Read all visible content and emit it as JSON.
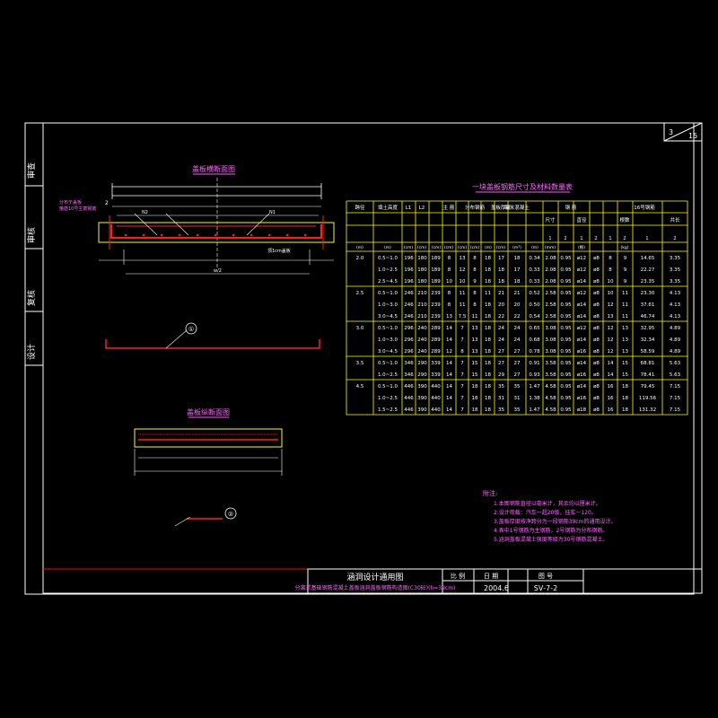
{
  "sheet": {
    "page_no": "3",
    "page_total": "15"
  },
  "side_labels": [
    "审查",
    "审核",
    "复核",
    "设计"
  ],
  "title_block": {
    "title": "涵洞设计通用图",
    "subtitle": "分离式基础钢筋混凝土盖板涵洞盖板钢筋构造图(C30砼)(h=39cm)",
    "scale_label": "比 例",
    "date_label": "日 期",
    "drawing_no_label": "图 号",
    "date_value": "2004.6",
    "drawing_no_value": "SⅤ-7-2"
  },
  "left_views": {
    "cross_section_title": "盖板横断面图",
    "detail_title": "盖板纵断面图",
    "callouts": [
      "①",
      "②"
    ],
    "notes": [
      "分布于盖板",
      "箍筋10号主筋钢筋",
      "2",
      "N2",
      "N1",
      "顶1cm盖板",
      "w/2"
    ]
  },
  "table": {
    "title": "一块盖板钢筋尺寸及材料数量表",
    "header_top": [
      "跨径",
      "填土高度",
      "L1",
      "L2",
      "主 筋",
      "分布钢筋",
      "盖板厚度",
      "每米混凝土",
      "钢 筋",
      "16号钢筋"
    ],
    "header_sub": [
      "尺寸",
      "直径",
      "根数",
      "共长"
    ],
    "units": [
      "(m)",
      "(m)",
      "(cm)",
      "(cm)",
      "(cm)",
      "(cm)",
      "(cm)",
      "(cm)",
      "(m)",
      "(cm)",
      "(m³)",
      "(m)",
      "(mm)",
      "(根)",
      "(kg)"
    ],
    "col_index": [
      "1",
      "2",
      "1",
      "2",
      "1",
      "2",
      "1",
      "2"
    ],
    "rows": [
      [
        "2.0",
        "0.5~1.0",
        "196",
        "180",
        "189",
        "8",
        "13",
        "8",
        "18",
        "17",
        "18",
        "0.34",
        "2.08",
        "0.95",
        "ø12",
        "ø8",
        "8",
        "9",
        "14.65",
        "3.35"
      ],
      [
        "",
        "1.0~2.5",
        "196",
        "180",
        "189",
        "8",
        "12",
        "8",
        "18",
        "18",
        "17",
        "0.33",
        "2.08",
        "0.95",
        "ø12",
        "ø8",
        "8",
        "9",
        "22.27",
        "3.35"
      ],
      [
        "",
        "2.5~4.5",
        "196",
        "180",
        "189",
        "10",
        "10",
        "9",
        "18",
        "18",
        "18",
        "0.33",
        "2.08",
        "0.95",
        "ø14",
        "ø8",
        "10",
        "9",
        "23.35",
        "3.35"
      ],
      [
        "2.5",
        "0.5~1.0",
        "246",
        "210",
        "239",
        "8",
        "11",
        "8",
        "11",
        "21",
        "21",
        "0.52",
        "2.58",
        "0.95",
        "ø12",
        "ø8",
        "10",
        "11",
        "23.30",
        "4.13"
      ],
      [
        "",
        "1.0~3.0",
        "246",
        "210",
        "239",
        "8",
        "11",
        "8",
        "18",
        "20",
        "20",
        "0.50",
        "2.58",
        "0.95",
        "ø14",
        "ø8",
        "12",
        "11",
        "37.61",
        "4.13"
      ],
      [
        "",
        "3.0~4.5",
        "246",
        "210",
        "239",
        "13",
        "7.5",
        "11",
        "18",
        "22",
        "22",
        "0.54",
        "2.58",
        "0.95",
        "ø14",
        "ø8",
        "13",
        "11",
        "46.74",
        "4.13"
      ],
      [
        "3.0",
        "0.5~1.0",
        "296",
        "240",
        "289",
        "14",
        "7",
        "13",
        "18",
        "24",
        "24",
        "0.65",
        "3.08",
        "0.95",
        "ø12",
        "ø8",
        "12",
        "13",
        "32.95",
        "4.89"
      ],
      [
        "",
        "1.0~3.0",
        "296",
        "240",
        "289",
        "14",
        "7",
        "13",
        "18",
        "24",
        "24",
        "0.68",
        "3.08",
        "0.95",
        "ø14",
        "ø8",
        "12",
        "13",
        "32.34",
        "4.89"
      ],
      [
        "",
        "3.0~4.5",
        "296",
        "240",
        "289",
        "12",
        "8",
        "13",
        "18",
        "27",
        "27",
        "0.78",
        "3.08",
        "0.95",
        "ø16",
        "ø8",
        "12",
        "13",
        "58.59",
        "4.89"
      ],
      [
        "3.5",
        "0.5~1.0",
        "346",
        "290",
        "339",
        "14",
        "7",
        "15",
        "18",
        "27",
        "27",
        "0.91",
        "3.58",
        "0.95",
        "ø14",
        "ø8",
        "14",
        "15",
        "68.81",
        "5.63"
      ],
      [
        "",
        "1.0~2.5",
        "346",
        "290",
        "339",
        "14",
        "7",
        "15",
        "18",
        "29",
        "27",
        "0.93",
        "3.58",
        "0.95",
        "ø16",
        "ø8",
        "14",
        "15",
        "78.41",
        "5.63"
      ],
      [
        "4.5",
        "0.5~1.0",
        "446",
        "390",
        "440",
        "14",
        "7",
        "18",
        "18",
        "35",
        "35",
        "1.47",
        "4.58",
        "0.95",
        "ø14",
        "ø8",
        "16",
        "18",
        "79.45",
        "7.15"
      ],
      [
        "",
        "1.0~2.5",
        "446",
        "390",
        "440",
        "14",
        "7",
        "18",
        "18",
        "31",
        "31",
        "1.38",
        "4.58",
        "0.95",
        "ø16",
        "ø8",
        "16",
        "18",
        "119.56",
        "7.15"
      ],
      [
        "",
        "1.5~2.5",
        "446",
        "390",
        "440",
        "14",
        "7",
        "18",
        "18",
        "35",
        "35",
        "1.47",
        "4.58",
        "0.95",
        "ø18",
        "ø8",
        "16",
        "18",
        "131.32",
        "7.15"
      ]
    ]
  },
  "notes": {
    "heading": "附注:",
    "lines": [
      "1.本图钢筋直径以毫米计，其余均以厘米计。",
      "2.设计荷载：汽车一超20级，挂车－120。",
      "3.盖板厚度按净跨分为一段钢筋39cm的通用设计。",
      "4.表中1号钢筋为主钢筋，2号钢筋为分布钢筋。",
      "5.涵洞盖板混凝土强度等级为30号钢筋混凝土。"
    ]
  },
  "colors": {
    "frame": "#ffffff",
    "border_red": "#ff0000",
    "table_line": "#ffff00",
    "table_text": "#ffffff",
    "title_magenta": "#ff55ff",
    "note_magenta": "#ff55ff",
    "rebar_red": "#ff2020",
    "dim_white": "#ffffff",
    "concrete_yellow": "#ffff00"
  }
}
